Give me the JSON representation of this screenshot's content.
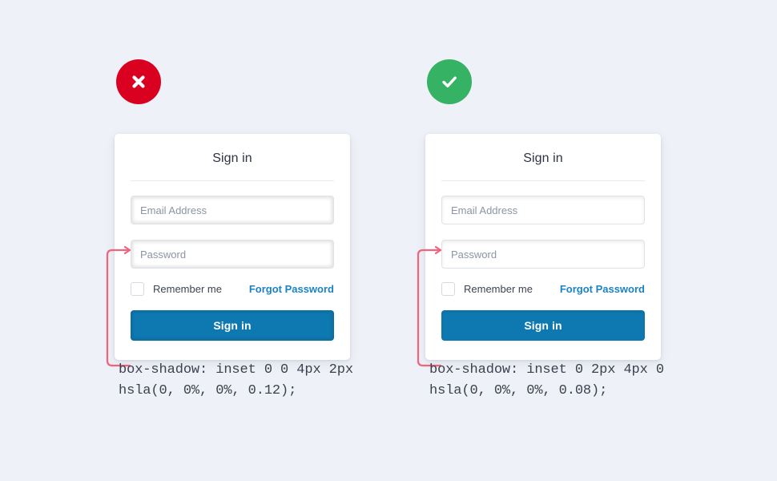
{
  "page": {
    "background_color": "#eef1f7"
  },
  "examples": [
    {
      "id": "bad",
      "status_icon": "close-circle-icon",
      "status_color": "#d9011f",
      "card": {
        "title": "Sign in",
        "email_placeholder": "Email Address",
        "password_placeholder": "Password",
        "email_value": "",
        "password_value": "",
        "remember_label": "Remember me",
        "forgot_label": "Forgot Password",
        "forgot_color": "#1b82c4",
        "submit_label": "Sign in",
        "submit_color": "#0e78b0"
      },
      "annotation": {
        "code": "box-shadow: inset 0 0 4px 2px hsla(0, 0%, 0%, 0.12);",
        "connector_color": "#f2647c"
      }
    },
    {
      "id": "good",
      "status_icon": "check-circle-icon",
      "status_color": "#36b264",
      "card": {
        "title": "Sign in",
        "email_placeholder": "Email Address",
        "password_placeholder": "Password",
        "email_value": "",
        "password_value": "",
        "remember_label": "Remember me",
        "forgot_label": "Forgot Password",
        "forgot_color": "#1b82c4",
        "submit_label": "Sign in",
        "submit_color": "#0e78b0"
      },
      "annotation": {
        "code": "box-shadow: inset 0 2px 4px 0 hsla(0, 0%, 0%, 0.08);",
        "connector_color": "#f2647c"
      }
    }
  ]
}
